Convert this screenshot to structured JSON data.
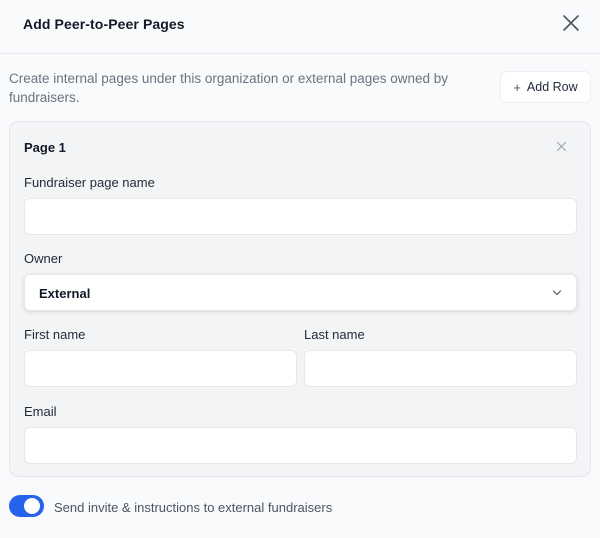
{
  "header": {
    "title": "Add Peer-to-Peer Pages",
    "close_icon": "close-icon"
  },
  "description": "Create internal pages under this organization or external pages owned by fundraisers.",
  "add_row": {
    "icon": "plus-icon",
    "label": "Add Row"
  },
  "page_card": {
    "title": "Page 1",
    "remove_icon": "close-icon",
    "fields": {
      "fundraiser_page_name": {
        "label": "Fundraiser page name",
        "value": ""
      },
      "owner": {
        "label": "Owner",
        "selected": "External",
        "icon": "chevron-down-icon"
      },
      "first_name": {
        "label": "First name",
        "value": ""
      },
      "last_name": {
        "label": "Last name",
        "value": ""
      },
      "email": {
        "label": "Email",
        "value": ""
      }
    }
  },
  "invite_toggle": {
    "label": "Send invite & instructions to external fundraisers",
    "on": true,
    "color": "#2563eb"
  }
}
